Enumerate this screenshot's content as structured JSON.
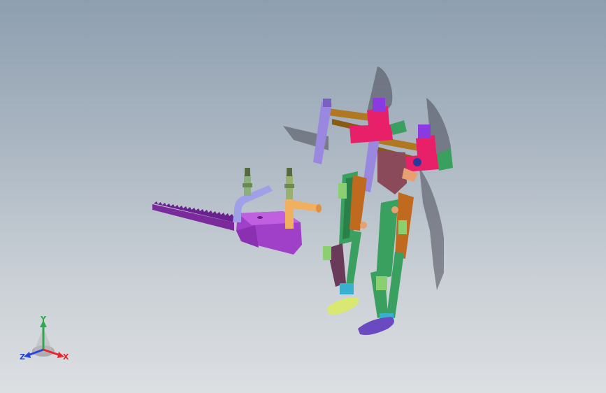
{
  "view": {
    "background_top": "#8e9fb0",
    "background_bottom": "#dcdfe2",
    "model": "exoskeleton-and-chainsaw-assembly"
  },
  "triad": {
    "x_label": "X",
    "y_label": "Y",
    "z_label": "Z",
    "x_color": "#e8262b",
    "y_color": "#2fa84f",
    "z_color": "#2847d6"
  },
  "parts": {
    "chainsaw_body_color": "#a040c8",
    "chainsaw_bar_color": "#7a2a9a",
    "left_handle_color": "#a0a0e8",
    "right_handle_color": "#f0b060",
    "frame_color": "#e8206a",
    "upright_color": "#9a88e0",
    "rail_color": "#b07820",
    "leg_color": "#3aa060",
    "thigh_color": "#c06a20",
    "foot_left_color": "#d8e870",
    "foot_right_color": "#6a4ac0",
    "shadow_color": "#4a4a58"
  }
}
